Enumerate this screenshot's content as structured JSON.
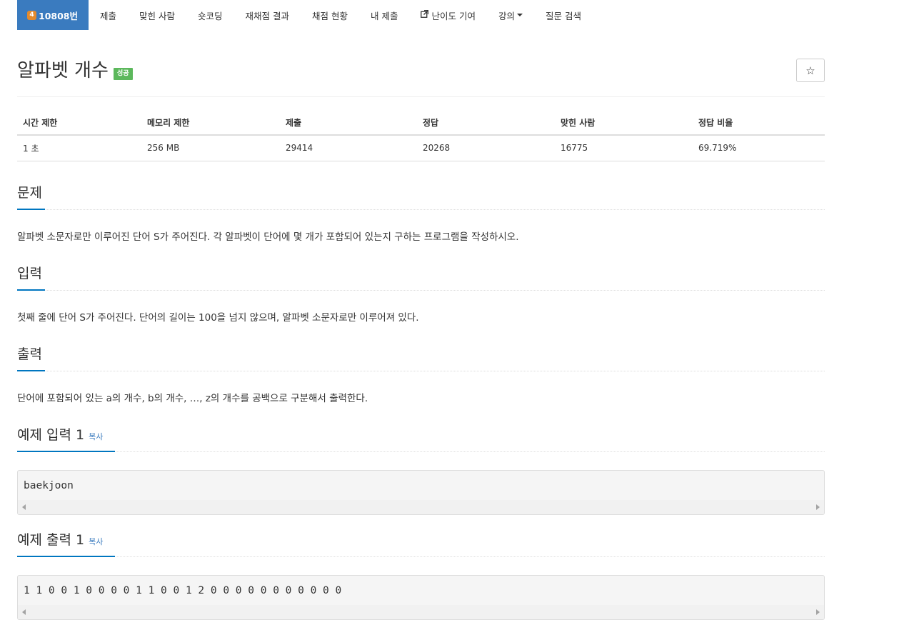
{
  "nav": {
    "problem_tab": {
      "tier": "4",
      "label": "10808번"
    },
    "tabs": [
      "제출",
      "맞힌 사람",
      "숏코딩",
      "재채점 결과",
      "채점 현황",
      "내 제출"
    ],
    "difficulty_contrib": "난이도 기여",
    "lecture": "강의",
    "question_search": "질문 검색"
  },
  "problem": {
    "title": "알파벳 개수",
    "status_badge": "성공",
    "star_icon": "☆"
  },
  "info_table": {
    "headers": [
      "시간 제한",
      "메모리 제한",
      "제출",
      "정답",
      "맞힌 사람",
      "정답 비율"
    ],
    "values": [
      "1 초",
      "256 MB",
      "29414",
      "20268",
      "16775",
      "69.719%"
    ]
  },
  "sections": {
    "description": {
      "title": "문제",
      "text": "알파벳 소문자로만 이루어진 단어 S가 주어진다. 각 알파벳이 단어에 몇 개가 포함되어 있는지 구하는 프로그램을 작성하시오."
    },
    "input": {
      "title": "입력",
      "text": "첫째 줄에 단어 S가 주어진다. 단어의 길이는 100을 넘지 않으며, 알파벳 소문자로만 이루어져 있다."
    },
    "output": {
      "title": "출력",
      "text": "단어에 포함되어 있는 a의 개수, b의 개수, …, z의 개수를 공백으로 구분해서 출력한다."
    }
  },
  "samples": {
    "input": {
      "title": "예제 입력 1",
      "copy": "복사",
      "content": "baekjoon"
    },
    "output": {
      "title": "예제 출력 1",
      "copy": "복사",
      "content": "1 1 0 0 1 0 0 0 0 1 1 0 0 1 2 0 0 0 0 0 0 0 0 0 0 0"
    }
  },
  "colors": {
    "nav_active": "#3a7bbf",
    "tier_badge": "#e38a2c",
    "success_badge": "#5cb85c",
    "section_underline": "#0076c0",
    "copy_link": "#3a7bbf"
  }
}
